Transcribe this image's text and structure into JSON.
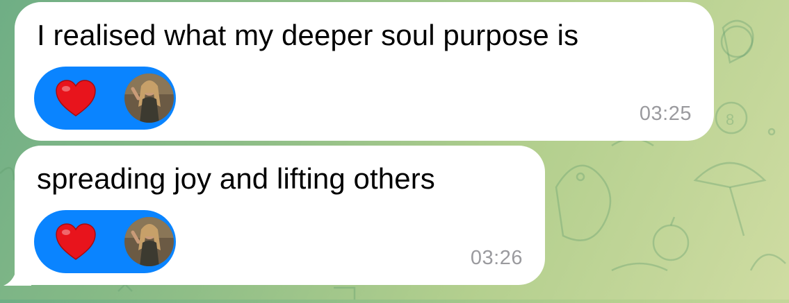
{
  "chat": {
    "messages": [
      {
        "text": "I realised what my deeper soul purpose is",
        "time": "03:25",
        "reaction": {
          "emoji_icon": "heart-icon",
          "avatar": "user-avatar"
        }
      },
      {
        "text": "spreading joy and lifting others",
        "time": "03:26",
        "reaction": {
          "emoji_icon": "heart-icon",
          "avatar": "user-avatar"
        }
      }
    ]
  },
  "colors": {
    "bubble": "#ffffff",
    "reaction_pill": "#0a84ff",
    "heart": "#e8141c",
    "timestamp": "#9a9a9e"
  }
}
